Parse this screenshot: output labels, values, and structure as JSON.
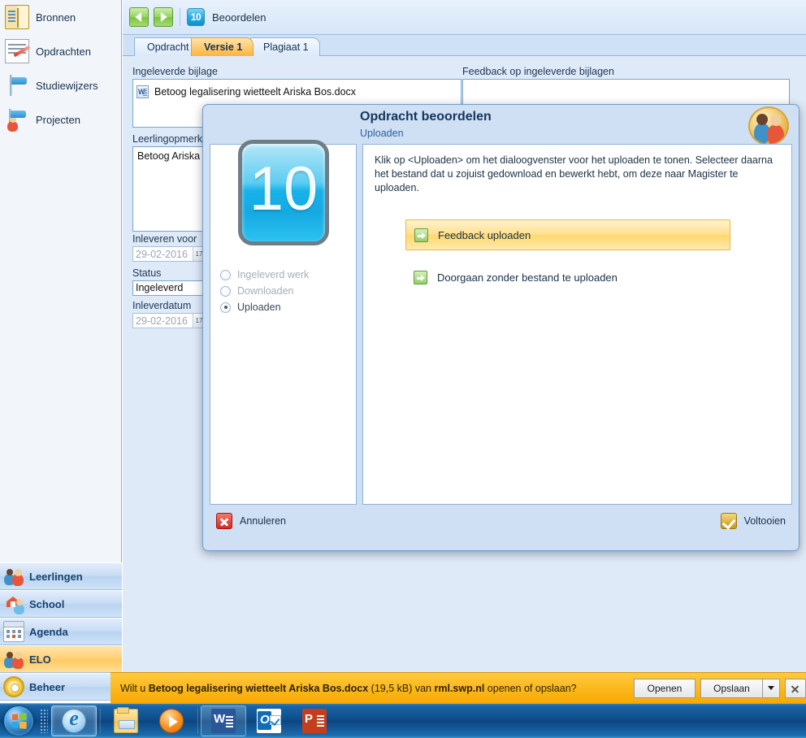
{
  "sidebar": {
    "top_items": [
      {
        "label": "Bronnen",
        "icon": "book-icon"
      },
      {
        "label": "Opdrachten",
        "icon": "assignment-pencil-icon"
      },
      {
        "label": "Studiewijzers",
        "icon": "signpost-icon"
      },
      {
        "label": "Projecten",
        "icon": "signpost-person-icon"
      }
    ],
    "modules": [
      {
        "label": "Leerlingen",
        "icon": "people-icon",
        "active": false
      },
      {
        "label": "School",
        "icon": "school-icon",
        "active": false
      },
      {
        "label": "Agenda",
        "icon": "calendar-icon",
        "active": false
      },
      {
        "label": "ELO",
        "icon": "people-icon",
        "active": true
      },
      {
        "label": "Beheer",
        "icon": "gear-icon",
        "active": false
      }
    ]
  },
  "topbar": {
    "back_icon": "arrow-left-icon",
    "forward_icon": "arrow-right-icon",
    "badge": "10",
    "breadcrumb": "Beoordelen"
  },
  "tabs": [
    {
      "label": "Opdracht",
      "selected": false
    },
    {
      "label": "Versie 1",
      "selected": true
    },
    {
      "label": "Plagiaat 1",
      "selected": false
    }
  ],
  "form": {
    "attachment_label": "Ingeleverde bijlage",
    "attachment_file": "Betoog legalisering wietteelt Ariska Bos.docx",
    "attachment_icon": "word-document-icon",
    "feedback_label": "Feedback op ingeleverde bijlagen",
    "feedback_value": "",
    "student_remark_label": "Leerlingopmerking",
    "student_remark_value": "Betoog Ariska",
    "due_label": "Inleveren voor",
    "due_value": "29-02-2016",
    "status_label": "Status",
    "status_value": "Ingeleverd",
    "submitted_label": "Inleverdatum",
    "submitted_value": "29-02-2016",
    "calendar_icon": "calendar-picker-icon"
  },
  "dialog": {
    "title": "Opdracht beoordelen",
    "subtitle": "Uploaden",
    "logo_text": "10",
    "avatar_icon": "two-people-avatar-icon",
    "instruction": "Klik op <Uploaden> om het dialoogvenster voor het uploaden te tonen. Selecteer daarna het bestand dat u zojuist gedownload en bewerkt hebt, om deze naar Magister te uploaden.",
    "steps": [
      {
        "label": "Ingeleverd werk",
        "selected": false,
        "disabled": true
      },
      {
        "label": "Downloaden",
        "selected": false,
        "disabled": true
      },
      {
        "label": "Uploaden",
        "selected": true,
        "disabled": false
      }
    ],
    "actions": [
      {
        "label": "Feedback uploaden",
        "icon": "green-arrow-icon",
        "highlighted": true
      },
      {
        "label": "Doorgaan zonder bestand te uploaden",
        "icon": "green-arrow-icon",
        "highlighted": false
      }
    ],
    "cancel_label": "Annuleren",
    "cancel_icon": "red-x-icon",
    "finish_label": "Voltooien",
    "finish_icon": "yellow-check-icon"
  },
  "download_bar": {
    "prefix": "Wilt u ",
    "filename": "Betoog legalisering wietteelt Ariska Bos.docx",
    "size": " (19,5 kB) van ",
    "host": "rml.swp.nl",
    "suffix": " openen of opslaan?",
    "open_label": "Openen",
    "save_label": "Opslaan",
    "caret_icon": "chevron-down-icon",
    "close_icon": "close-icon"
  },
  "taskbar": {
    "start_icon": "windows-start-orb-icon",
    "buttons": [
      {
        "icon": "internet-explorer-icon",
        "state": "pinned-active"
      },
      {
        "icon": "file-explorer-icon",
        "state": "plain"
      },
      {
        "icon": "media-player-icon",
        "state": "plain"
      },
      {
        "icon": "word-icon",
        "state": "running"
      },
      {
        "icon": "outlook-icon",
        "state": "plain"
      },
      {
        "icon": "powerpoint-icon",
        "state": "plain"
      }
    ]
  },
  "colors": {
    "accent_orange": "#ffb43d",
    "panel_blue": "#dfeaf9",
    "sidebar_blue": "#c8dcf4",
    "download_bar": "#f8a900",
    "dialog_bg": "#cfe0f5"
  }
}
